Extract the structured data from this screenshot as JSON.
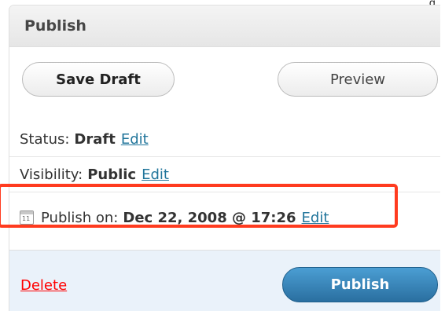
{
  "corner_mark": "g",
  "panel": {
    "title": "Publish"
  },
  "buttons": {
    "save_draft": "Save Draft",
    "preview": "Preview"
  },
  "status": {
    "label": "Status:",
    "value": "Draft",
    "edit": "Edit"
  },
  "visibility": {
    "label": "Visibility:",
    "value": "Public",
    "edit": "Edit"
  },
  "publish_on": {
    "icon_day": "11",
    "label": "Publish on:",
    "value": "Dec 22, 2008 @ 17:26",
    "edit": "Edit"
  },
  "footer": {
    "delete": "Delete",
    "publish": "Publish"
  },
  "colors": {
    "link": "#21759b",
    "delete": "#ff0000",
    "highlight": "#ff3b1f",
    "publish_button": "#2e7bb0",
    "footer_bg": "#eaf2fa"
  },
  "icons": {
    "publish_on": "calendar-icon"
  }
}
